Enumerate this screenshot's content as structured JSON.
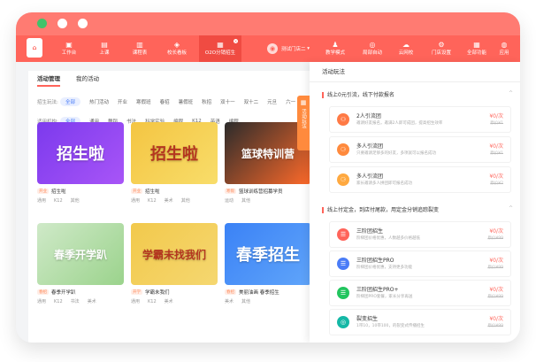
{
  "nav": {
    "items": [
      {
        "label": "工作台",
        "icon": "home-icon"
      },
      {
        "label": "上课",
        "icon": "class-icon"
      },
      {
        "label": "课程表",
        "icon": "calendar-icon"
      },
      {
        "label": "校长看板",
        "icon": "dashboard-icon"
      },
      {
        "label": "O2O分销招生",
        "icon": "store-icon"
      }
    ],
    "shop_name": "测试门店二",
    "right_items": [
      {
        "label": "教学模式",
        "icon": "teach-icon"
      },
      {
        "label": "局部自动",
        "icon": "auto-icon"
      },
      {
        "label": "云网校",
        "icon": "cloud-icon"
      },
      {
        "label": "门店设置",
        "icon": "settings-icon"
      },
      {
        "label": "全部功能",
        "icon": "grid-icon"
      },
      {
        "label": "应用",
        "icon": "app-icon"
      }
    ]
  },
  "main": {
    "tabs": [
      "活动管理",
      "我的活动"
    ],
    "filters": [
      {
        "label": "招生玩法:",
        "options": [
          "全部",
          "热门活动",
          "开业",
          "寒假班",
          "春招",
          "暑假班",
          "秋招",
          "双十一",
          "双十二",
          "元旦",
          "六一"
        ]
      },
      {
        "label": "适用机构:",
        "options": [
          "全部",
          "通用",
          "舞蹈",
          "书法",
          "科学实验",
          "编程",
          "K12",
          "英语",
          "编程"
        ]
      }
    ],
    "cards": [
      {
        "title": "招生啦",
        "tag": "开业",
        "meta": [
          "通用",
          "K12",
          "其他"
        ],
        "banner": "招生啦",
        "colors": [
          "#7c3aed",
          "#a855f7"
        ]
      },
      {
        "title": "招生啦",
        "tag": "开业",
        "meta": [
          "通用",
          "K12",
          "美术",
          "其他"
        ],
        "banner": "招生啦",
        "colors": [
          "#f4c542",
          "#f8dd6a"
        ]
      },
      {
        "title": "篮球训练营招募学员",
        "tag": "寒假",
        "meta": [
          "运动",
          "其他"
        ],
        "banner": "篮球特训营",
        "colors": [
          "#2b2b2b",
          "#ff6a2a"
        ]
      },
      {
        "title": "春季开学趴",
        "tag": "春招",
        "meta": [
          "通用",
          "K12",
          "书法",
          "美术"
        ],
        "banner": "春季开学趴",
        "colors": [
          "#cfe9c8",
          "#9bd38c"
        ]
      },
      {
        "title": "学霸未我们",
        "tag": "开学",
        "meta": [
          "通用",
          "K12",
          "美术"
        ],
        "banner": "学霸未找我们",
        "colors": [
          "#f2c94c",
          "#f5d770"
        ]
      },
      {
        "title": "美丽油画 春季招生",
        "tag": "春招",
        "meta": [
          "美术",
          "其他"
        ],
        "banner": "春季招生",
        "colors": [
          "#3b82f6",
          "#60a5fa"
        ]
      }
    ]
  },
  "panel": {
    "title": "活动玩法",
    "side_tab": "活动玩法",
    "sections": [
      {
        "title": "线上0元引流，线下付款报名",
        "acts": [
          {
            "name": "2人引流团",
            "desc": "邀请好友报名，邀满2人即可成团，提高招生效率",
            "price": "¥0/次",
            "orig": "原价¥1",
            "icon": "group-icon",
            "color": "#ff7a45"
          },
          {
            "name": "多人引流团",
            "desc": "只要邀请足够多的好友，多项就可以报名成功",
            "price": "¥0/次",
            "orig": "原价¥1",
            "icon": "multi-icon",
            "color": "#ff8a3d"
          },
          {
            "name": "多人引流团",
            "desc": "家长邀请多人拼团即可报名成功",
            "price": "¥0/次",
            "orig": "原价¥2",
            "icon": "multi-icon",
            "color": "#ffa940"
          }
        ]
      },
      {
        "title": "线上付定金，到店付尾款，用定金分销追踪裂变",
        "acts": [
          {
            "name": "三阶团招生",
            "desc": "阶梯团价格优惠，人数越多价格越低",
            "price": "¥0/次",
            "orig": "原价¥99",
            "icon": "tier-icon",
            "color": "#ff645a"
          },
          {
            "name": "三阶团招生PRO",
            "desc": "阶梯团价格优惠，支持更多功能",
            "price": "¥0/次",
            "orig": "原价¥99",
            "icon": "tier-icon",
            "color": "#4a7cf7"
          },
          {
            "name": "三阶团招生PRO+",
            "desc": "阶梯团PRO套餐，家长分享再送",
            "price": "¥0/次",
            "orig": "原价¥99",
            "icon": "tier-icon",
            "color": "#22c55e"
          },
          {
            "name": "裂变招生",
            "desc": "1带10，10带100，的裂变式传播招生",
            "price": "¥0/次",
            "orig": "原价¥99",
            "icon": "share-icon",
            "color": "#14b8a6"
          }
        ]
      }
    ]
  }
}
